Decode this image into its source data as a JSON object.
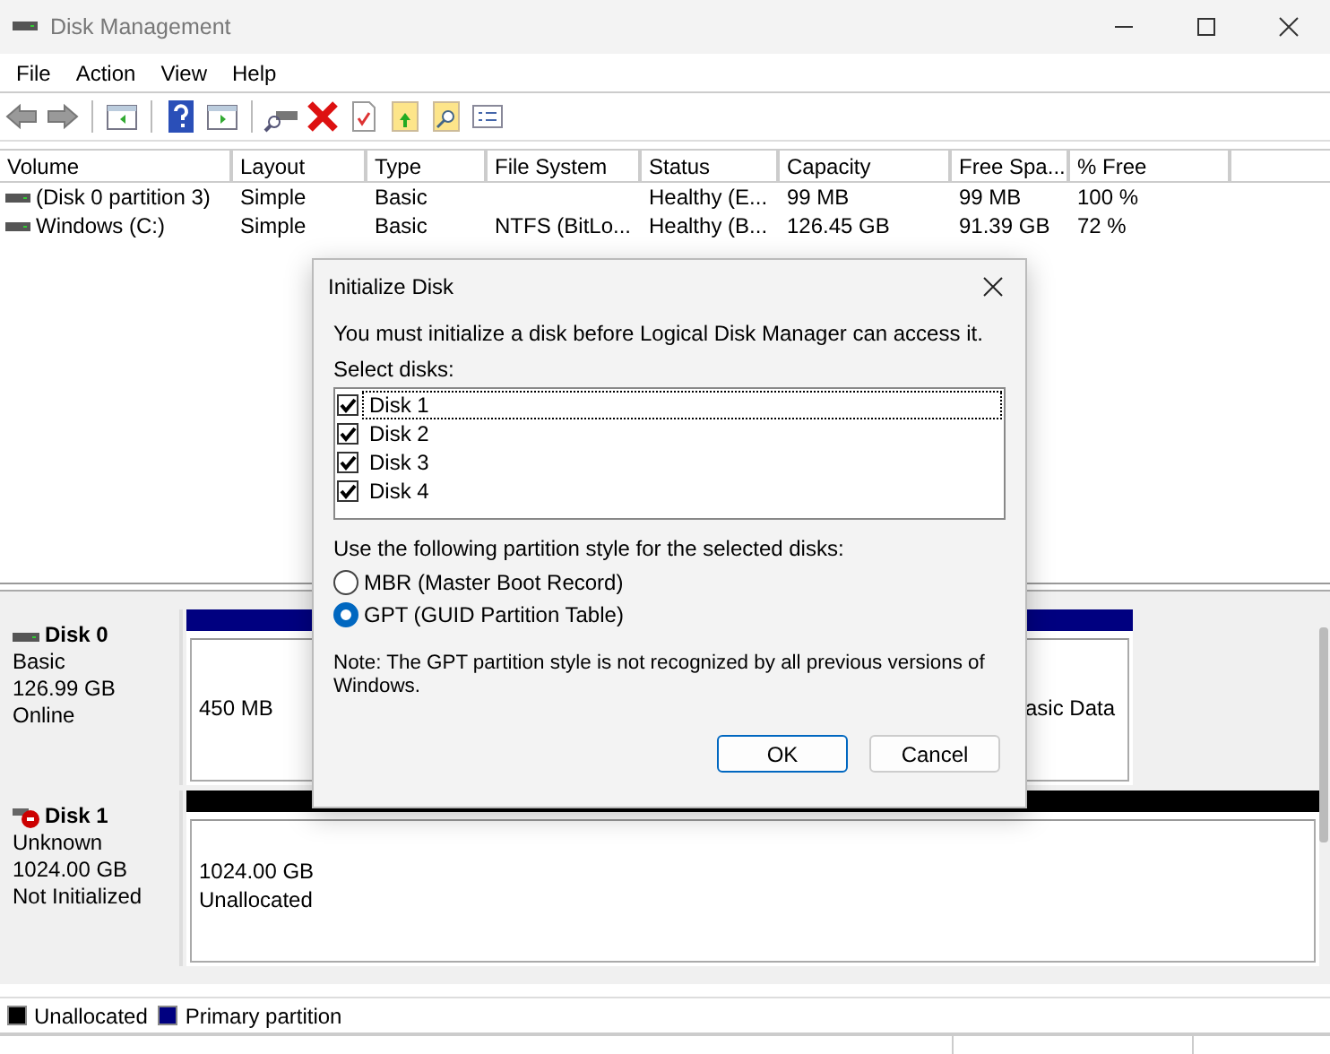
{
  "window": {
    "title": "Disk Management"
  },
  "menu": [
    "File",
    "Action",
    "View",
    "Help"
  ],
  "volume_table": {
    "columns": [
      "Volume",
      "Layout",
      "Type",
      "File System",
      "Status",
      "Capacity",
      "Free Spa...",
      "% Free"
    ],
    "rows": [
      [
        "(Disk 0 partition 3)",
        "Simple",
        "Basic",
        "",
        "Healthy (E...",
        "99 MB",
        "99 MB",
        "100 %"
      ],
      [
        "Windows (C:)",
        "Simple",
        "Basic",
        "NTFS (BitLo...",
        "Healthy (B...",
        "126.45 GB",
        "91.39 GB",
        "72 %"
      ]
    ]
  },
  "disks": [
    {
      "name": "Disk 0",
      "kind": "online",
      "lines": [
        "Basic",
        "126.99 GB",
        "Online"
      ],
      "partitions": [
        {
          "kind": "primary",
          "lines": [
            "450 MB"
          ]
        },
        {
          "kind": "primary",
          "lines": [
            "asic Data"
          ]
        }
      ]
    },
    {
      "name": "Disk 1",
      "kind": "offline",
      "lines": [
        "Unknown",
        "1024.00 GB",
        "Not Initialized"
      ],
      "partitions": [
        {
          "kind": "unallocated",
          "lines": [
            "1024.00 GB",
            "Unallocated"
          ]
        }
      ]
    }
  ],
  "legend": [
    {
      "label": "Unallocated",
      "color": "#000000"
    },
    {
      "label": "Primary partition",
      "color": "#000080"
    }
  ],
  "dialog": {
    "title": "Initialize Disk",
    "message": "You must initialize a disk before Logical Disk Manager can access it.",
    "select_label": "Select disks:",
    "disks": [
      {
        "label": "Disk 1",
        "checked": true,
        "selected": true
      },
      {
        "label": "Disk 2",
        "checked": true,
        "selected": false
      },
      {
        "label": "Disk 3",
        "checked": true,
        "selected": false
      },
      {
        "label": "Disk 4",
        "checked": true,
        "selected": false
      }
    ],
    "style_label": "Use the following partition style for the selected disks:",
    "styles": [
      {
        "label": "MBR (Master Boot Record)",
        "selected": false
      },
      {
        "label": "GPT (GUID Partition Table)",
        "selected": true
      }
    ],
    "note": "Note: The GPT partition style is not recognized by all previous versions of Windows.",
    "buttons": [
      "OK",
      "Cancel"
    ]
  }
}
